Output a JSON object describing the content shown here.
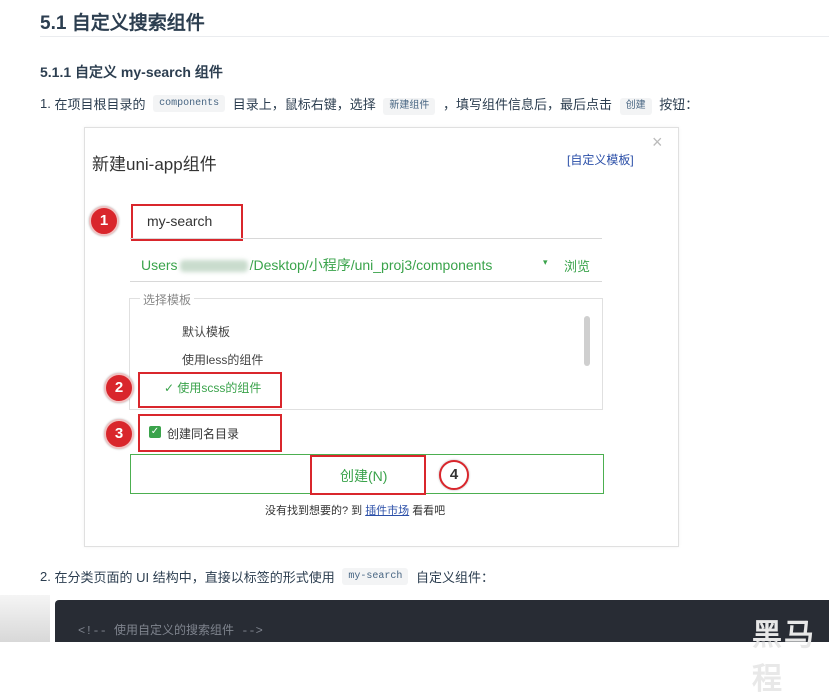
{
  "section_title": "5.1 自定义搜索组件",
  "subsection_title": "5.1.1 自定义 my-search 组件",
  "step1": {
    "num": "1.",
    "t1": "在项目根目录的",
    "code1": "components",
    "t2": "目录上，鼠标右键，选择",
    "code2": "新建组件",
    "t3": "，填写组件信息后，最后点击",
    "code3": "创建",
    "t4": "按钮："
  },
  "dialog": {
    "title": "新建uni-app组件",
    "custom_template_link": "[自定义模板]",
    "close": "×",
    "name_value": "my-search",
    "path_prefix": "Users",
    "path_suffix": "/Desktop/小程序/uni_proj3/components",
    "path_dropdown": "▾",
    "browse": "浏览",
    "template_legend": "选择模板",
    "templates": [
      "默认模板",
      "使用less的组件",
      "使用scss的组件"
    ],
    "selected_mark": "✓",
    "create_dir_label": "创建同名目录",
    "checkbox_mark": "✓",
    "create_button": "创建(N)",
    "footer_t1": "没有找到想要的? 到",
    "footer_link": "插件市场",
    "footer_t2": "看看吧"
  },
  "badges": [
    "1",
    "2",
    "3",
    "4"
  ],
  "step2": {
    "num": "2.",
    "t1": "在分类页面的 UI 结构中，直接以标签的形式使用",
    "code1": "my-search",
    "t2": "自定义组件："
  },
  "code_comment": "<!-- 使用自定义的搜索组件 -->",
  "watermark": "黑马程",
  "colors": {
    "accent_green": "#3aa34b",
    "annotation_red": "#d9262c",
    "link_blue": "#2b4fa8"
  }
}
